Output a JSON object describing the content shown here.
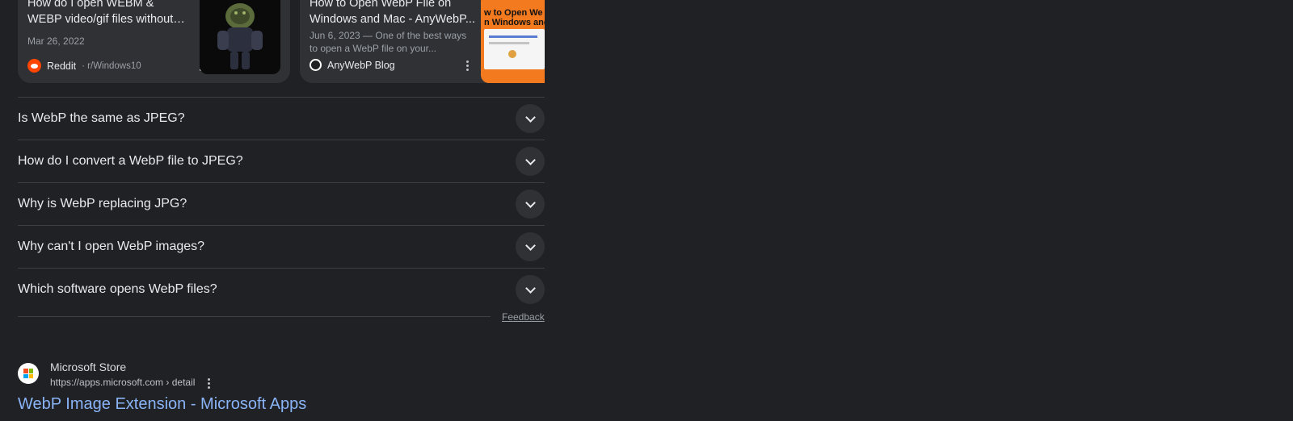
{
  "cards": [
    {
      "title": "How do I open WEBM & WEBP video/gif files without an...",
      "date": "Mar 26, 2022",
      "source": "Reddit",
      "source_sub": "· r/Windows10"
    },
    {
      "title": "How to Open WebP File on Windows and Mac - AnyWebP...",
      "snippet": "Jun 6, 2023 — One of the best ways to open a WebP file on your...",
      "source": "AnyWebP Blog",
      "thumb_text": "w to Open We\nn Windows and"
    }
  ],
  "faq": [
    "Is WebP the same as JPEG?",
    "How do I convert a WebP file to JPEG?",
    "Why is WebP replacing JPG?",
    "Why can't I open WebP images?",
    "Which software opens WebP files?"
  ],
  "feedback_label": "Feedback",
  "result": {
    "site_name": "Microsoft Store",
    "url": "https://apps.microsoft.com › detail",
    "title": "WebP Image Extension - Microsoft Apps"
  },
  "colors": {
    "background": "#202124",
    "card": "#303134",
    "link": "#8ab4f8",
    "reddit": "#ff4500",
    "thumb_orange": "#f47a20"
  }
}
